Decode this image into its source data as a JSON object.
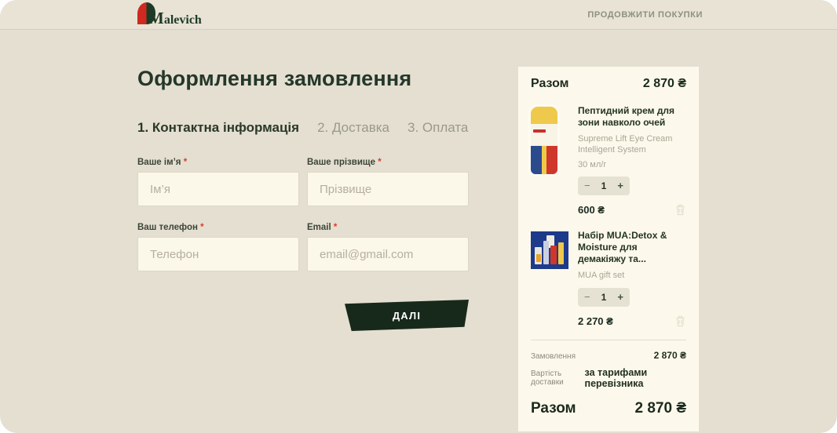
{
  "header": {
    "logo_text": "Malevich",
    "continue_shopping": "ПРОДОВЖИТИ ПОКУПКИ"
  },
  "checkout": {
    "title": "Оформлення замовлення",
    "steps": [
      {
        "label": "1. Контактна інформація",
        "active": true
      },
      {
        "label": "2. Доставка",
        "active": false
      },
      {
        "label": "3. Оплата",
        "active": false
      }
    ],
    "fields": [
      {
        "label": "Ваше ім’я",
        "required": "*",
        "placeholder": "Ім’я"
      },
      {
        "label": "Ваше прізвище",
        "required": "*",
        "placeholder": "Прізвище"
      },
      {
        "label": "Ваш телефон",
        "required": "*",
        "placeholder": "Телефон"
      },
      {
        "label": "Email",
        "required": "*",
        "placeholder": "email@gmail.com"
      }
    ],
    "next_button": "ДАЛІ"
  },
  "cart": {
    "header_label": "Разом",
    "header_total": "2 870 ₴",
    "stepper": {
      "minus": "−",
      "plus": "+"
    },
    "items": [
      {
        "title": "Пептидний крем для зони навколо очей",
        "subtitle": "Supreme Lift Eye Cream Intelligent System",
        "volume": "30 мл/г",
        "qty": "1",
        "price": "600 ₴"
      },
      {
        "title": "Набір MUA:Detox & Moisture для демакіяжу та...",
        "subtitle": "MUA gift set",
        "volume": "",
        "qty": "1",
        "price": "2 270 ₴"
      }
    ],
    "summary": {
      "order_label": "Замовлення",
      "order_value": "2 870 ₴",
      "delivery_label": "Вартість доставки",
      "delivery_value": "за тарифами перевізника",
      "total_label": "Разом",
      "total_value": "2 870 ₴"
    }
  },
  "colors": {
    "brand_green": "#1d3a26",
    "brand_red": "#ce2a20",
    "page_bg": "#e4dfd1",
    "card_bg": "#fcf9ec",
    "button_bg": "#17291b",
    "required_red": "#e03a2a"
  }
}
